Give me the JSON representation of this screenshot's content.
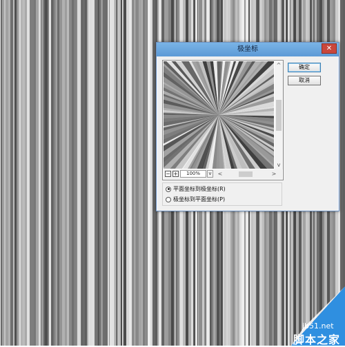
{
  "dialog": {
    "title": "极坐标",
    "close_icon": "close-icon",
    "ok_label": "确定",
    "cancel_label": "取消",
    "zoom_value": "100%",
    "options": [
      {
        "label": "平面坐标到极坐标(R)",
        "selected": true
      },
      {
        "label": "极坐标到平面坐标(P)",
        "selected": false
      }
    ],
    "scroll_up_icon": "chevron-up-icon",
    "scroll_down_icon": "chevron-down-icon",
    "scroll_left_icon": "chevron-left-icon",
    "scroll_right_icon": "chevron-right-icon",
    "zoom_out_icon": "minus-icon",
    "zoom_in_icon": "plus-icon"
  },
  "watermark": {
    "site": "jb51.net",
    "name": "脚本之家"
  },
  "colors": {
    "title_bar": "#6aa8e0",
    "close_button": "#c9473c",
    "watermark_bg": "#2f8fe0"
  }
}
